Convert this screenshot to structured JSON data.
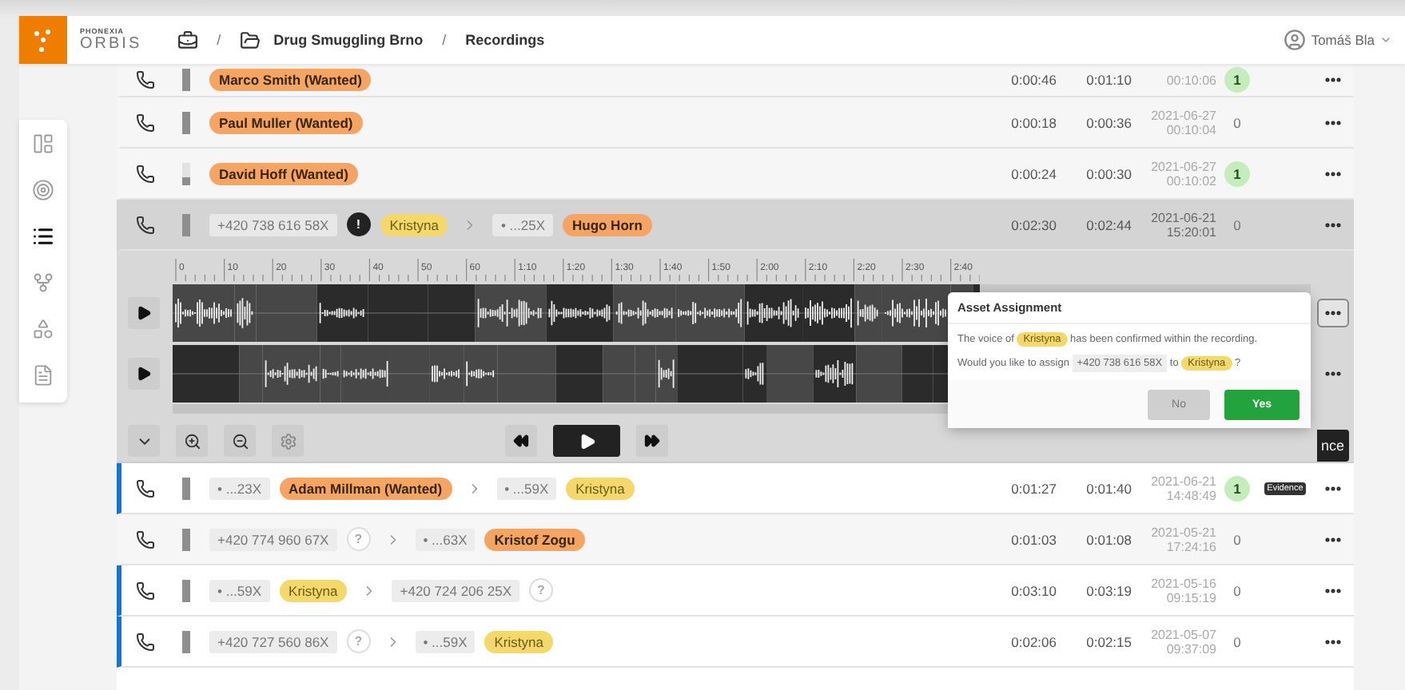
{
  "header": {
    "logo_top": "PHONEXIA",
    "logo_bottom": "ORBIS",
    "breadcrumb": [
      {
        "kind": "cases"
      },
      {
        "kind": "folder",
        "separator": "/",
        "label": "Drug Smuggling Brno"
      },
      {
        "kind": "page",
        "separator": "/",
        "label": "Recordings"
      }
    ],
    "user": {
      "name": "Tomáš Bla"
    }
  },
  "sidebar": [
    {
      "kind": "dashboard",
      "selected": false
    },
    {
      "kind": "target",
      "selected": false
    },
    {
      "kind": "list",
      "selected": true
    },
    {
      "kind": "graph",
      "selected": false
    },
    {
      "kind": "shapes",
      "selected": false
    },
    {
      "kind": "report",
      "selected": false
    }
  ],
  "rows": [
    {
      "flagged": false,
      "expanded": false,
      "level": 1,
      "parties": [
        {
          "kind": "suspect",
          "text": "Marco Smith (Wanted)",
          "color": "#f4a564"
        }
      ],
      "duration": "0:00:46",
      "total": "0:01:10",
      "time": "00:10:06",
      "count": "1",
      "confirmed": true
    },
    {
      "flagged": false,
      "expanded": false,
      "level": 1,
      "parties": [
        {
          "kind": "suspect",
          "text": "Paul Muller (Wanted)",
          "color": "#f4a564"
        }
      ],
      "duration": "0:00:18",
      "total": "0:00:36",
      "date": "2021-06-27",
      "time": "00:10:04",
      "count": "0",
      "confirmed": false
    },
    {
      "flagged": false,
      "expanded": false,
      "level": 0.3,
      "parties": [
        {
          "kind": "suspect",
          "text": "David Hoff (Wanted)",
          "color": "#f4a564"
        }
      ],
      "duration": "0:00:24",
      "total": "0:00:30",
      "date": "2021-06-27",
      "time": "00:10:02",
      "count": "1",
      "confirmed": true
    },
    {
      "flagged": false,
      "expanded": true,
      "level": 1,
      "parties": [
        {
          "kind": "number",
          "text": "+420 738 616 58X",
          "badge": {
            "kind": "alert",
            "text": "!"
          }
        },
        {
          "kind": "contact",
          "text": "Kristyna",
          "color": "#f5d86c"
        },
        {
          "kind": "arrow"
        },
        {
          "kind": "number",
          "text": "• ...25X"
        },
        {
          "kind": "suspect",
          "text": "Hugo Horn",
          "color": "#f4a564"
        }
      ],
      "duration": "0:02:30",
      "total": "0:02:44",
      "date": "2021-06-21",
      "time": "15:20:01",
      "count": "0",
      "confirmed": false
    },
    {
      "flagged": true,
      "expanded": false,
      "level": 1,
      "parties": [
        {
          "kind": "number",
          "text": "• ...23X"
        },
        {
          "kind": "suspect",
          "text": "Adam Millman (Wanted)",
          "color": "#f4a564"
        },
        {
          "kind": "arrow"
        },
        {
          "kind": "number",
          "text": "• ...59X"
        },
        {
          "kind": "contact",
          "text": "Kristyna",
          "color": "#f5d86c"
        }
      ],
      "duration": "0:01:27",
      "total": "0:01:40",
      "date": "2021-06-21",
      "time": "14:48:49",
      "count": "1",
      "confirmed": true,
      "tag": "Evidence"
    },
    {
      "flagged": false,
      "expanded": false,
      "level": 1,
      "parties": [
        {
          "kind": "number",
          "text": "+420 774 960 67X",
          "badge": {
            "kind": "unknown",
            "text": "?"
          }
        },
        {
          "kind": "arrow"
        },
        {
          "kind": "number",
          "text": "• ...63X"
        },
        {
          "kind": "suspect",
          "text": "Kristof Zogu",
          "color": "#f4a564"
        }
      ],
      "duration": "0:01:03",
      "total": "0:01:08",
      "date": "2021-05-21",
      "time": "17:24:16",
      "count": "0",
      "confirmed": false
    },
    {
      "flagged": true,
      "expanded": false,
      "level": 1,
      "parties": [
        {
          "kind": "number",
          "text": "• ...59X"
        },
        {
          "kind": "contact",
          "text": "Kristyna",
          "color": "#f5d86c"
        },
        {
          "kind": "arrow"
        },
        {
          "kind": "number",
          "text": "+420 724 206 25X",
          "badge": {
            "kind": "unknown",
            "text": "?"
          }
        }
      ],
      "duration": "0:03:10",
      "total": "0:03:19",
      "date": "2021-05-16",
      "time": "09:15:19",
      "count": "0",
      "confirmed": false
    },
    {
      "flagged": true,
      "expanded": false,
      "level": 1,
      "parties": [
        {
          "kind": "number",
          "text": "+420 727 560 86X",
          "badge": {
            "kind": "unknown",
            "text": "?"
          }
        },
        {
          "kind": "arrow"
        },
        {
          "kind": "number",
          "text": "• ...59X"
        },
        {
          "kind": "contact",
          "text": "Kristyna",
          "color": "#f5d86c"
        }
      ],
      "duration": "0:02:06",
      "total": "0:02:15",
      "date": "2021-05-07",
      "time": "09:37:09",
      "count": "0",
      "confirmed": false
    }
  ],
  "player": {
    "ruler": [
      "0",
      "10",
      "20",
      "30",
      "40",
      "50",
      "60",
      "1:10",
      "1:20",
      "1:30",
      "1:40",
      "1:50",
      "2:00",
      "2:10",
      "2:20",
      "2:30",
      "2:40"
    ],
    "lanes": [
      {
        "menu_open": true
      },
      {
        "menu_open": false
      }
    ],
    "action_label": "nce"
  },
  "popup": {
    "title": "Asset Assignment",
    "paragraphs": [
      [
        {
          "text": "The voice of "
        },
        {
          "chip": "Kristyna",
          "color": "#f5d86c"
        },
        {
          "text": " has been confirmed within the recording."
        }
      ],
      [
        {
          "text": "Would you like to assign "
        },
        {
          "number": "+420 738 616 58X"
        },
        {
          "text": " to "
        },
        {
          "chip": "Kristyna",
          "color": "#f5d86c"
        },
        {
          "text": " ?"
        }
      ]
    ],
    "buttons": [
      {
        "kind": "secondary",
        "label": "No"
      },
      {
        "kind": "primary",
        "label": "Yes"
      }
    ]
  }
}
